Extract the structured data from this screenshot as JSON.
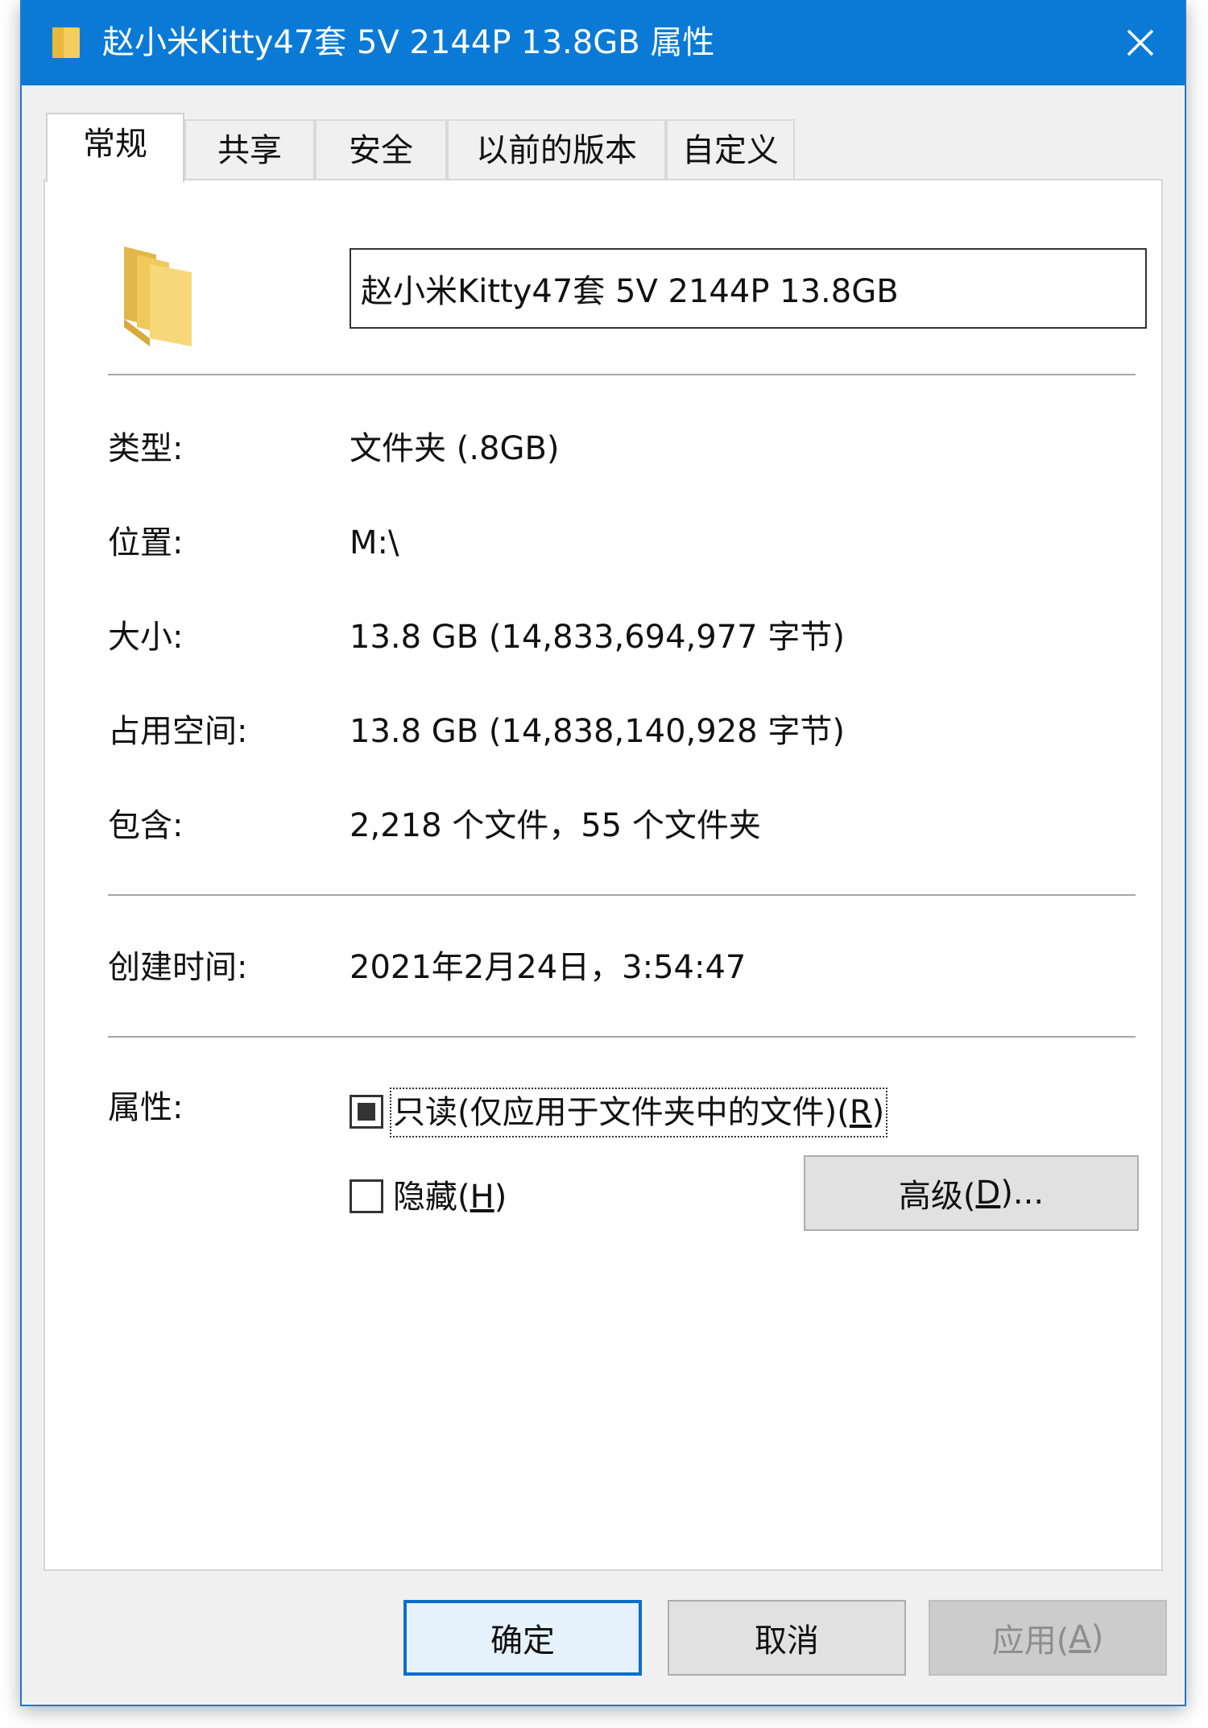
{
  "window": {
    "title": "赵小米Kitty47套 5V 2144P 13.8GB 属性",
    "close_symbol": "×"
  },
  "tabs": [
    {
      "label": "常规",
      "active": true
    },
    {
      "label": "共享",
      "active": false
    },
    {
      "label": "安全",
      "active": false
    },
    {
      "label": "以前的版本",
      "active": false
    },
    {
      "label": "自定义",
      "active": false
    }
  ],
  "general": {
    "folder_name": "赵小米Kitty47套 5V 2144P 13.8GB",
    "type_label": "类型:",
    "type_value": "文件夹 (.8GB)",
    "location_label": "位置:",
    "location_value": "M:\\",
    "size_label": "大小:",
    "size_value": "13.8 GB (14,833,694,977 字节)",
    "size_on_disk_label": "占用空间:",
    "size_on_disk_value": "13.8 GB (14,838,140,928 字节)",
    "contains_label": "包含:",
    "contains_value": "2,218 个文件，55 个文件夹",
    "created_label": "创建时间:",
    "created_value": "2021年2月24日，3:54:47",
    "attributes_label": "属性:",
    "readonly_label": "只读(仅应用于文件夹中的文件)(",
    "readonly_key": "R",
    "readonly_close": ")",
    "readonly_state": "indeterminate",
    "hidden_label": "隐藏(",
    "hidden_key": "H",
    "hidden_close": ")",
    "hidden_checked": false,
    "advanced_label": "高级(",
    "advanced_key": "D",
    "advanced_close": ")..."
  },
  "footer": {
    "ok_label": "确定",
    "cancel_label": "取消",
    "apply_label": "应用(",
    "apply_key": "A",
    "apply_close": ")"
  },
  "colors": {
    "titlebar": "#0a7ad6",
    "folder_yellow": "#f3cd5e"
  },
  "icons": {
    "title_icon": "folder-icon",
    "close_icon": "close-icon",
    "panel_icon": "folder-icon"
  }
}
